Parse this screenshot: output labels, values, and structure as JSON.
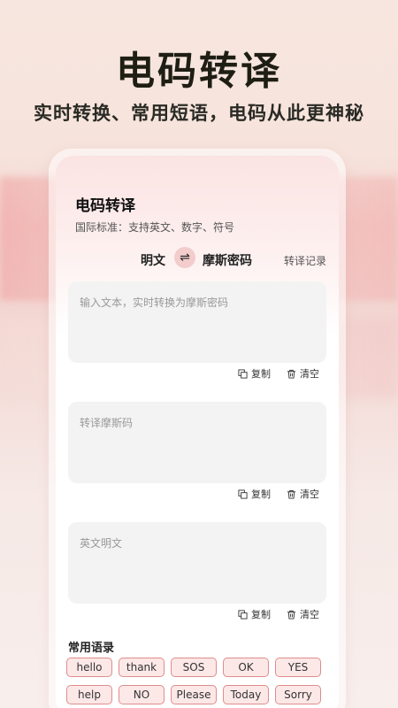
{
  "promo": {
    "headline": "电码转译",
    "subline": "实时转换、常用短语，电码从此更神秘"
  },
  "app": {
    "title": "电码转译",
    "subtitle": "国际标准：支持英文、数字、符号",
    "lang_from": "明文",
    "lang_to": "摩斯密码",
    "swap_icon": "swap-arrows-icon",
    "history_label": "转译记录"
  },
  "boxes": [
    {
      "placeholder": "输入文本，实时转换为摩斯密码",
      "copy_label": "复制",
      "clear_label": "清空"
    },
    {
      "placeholder": "转译摩斯码",
      "copy_label": "复制",
      "clear_label": "清空"
    },
    {
      "placeholder": "英文明文",
      "copy_label": "复制",
      "clear_label": "清空"
    }
  ],
  "phrases": {
    "label": "常用语录",
    "items": [
      "hello",
      "thank",
      "SOS",
      "OK",
      "YES",
      "help",
      "NO",
      "Please",
      "Today",
      "Sorry"
    ]
  },
  "colors": {
    "chip_border": "#e08c8c",
    "chip_bg": "#fde8e8",
    "swap_bg": "#f3cccc"
  }
}
